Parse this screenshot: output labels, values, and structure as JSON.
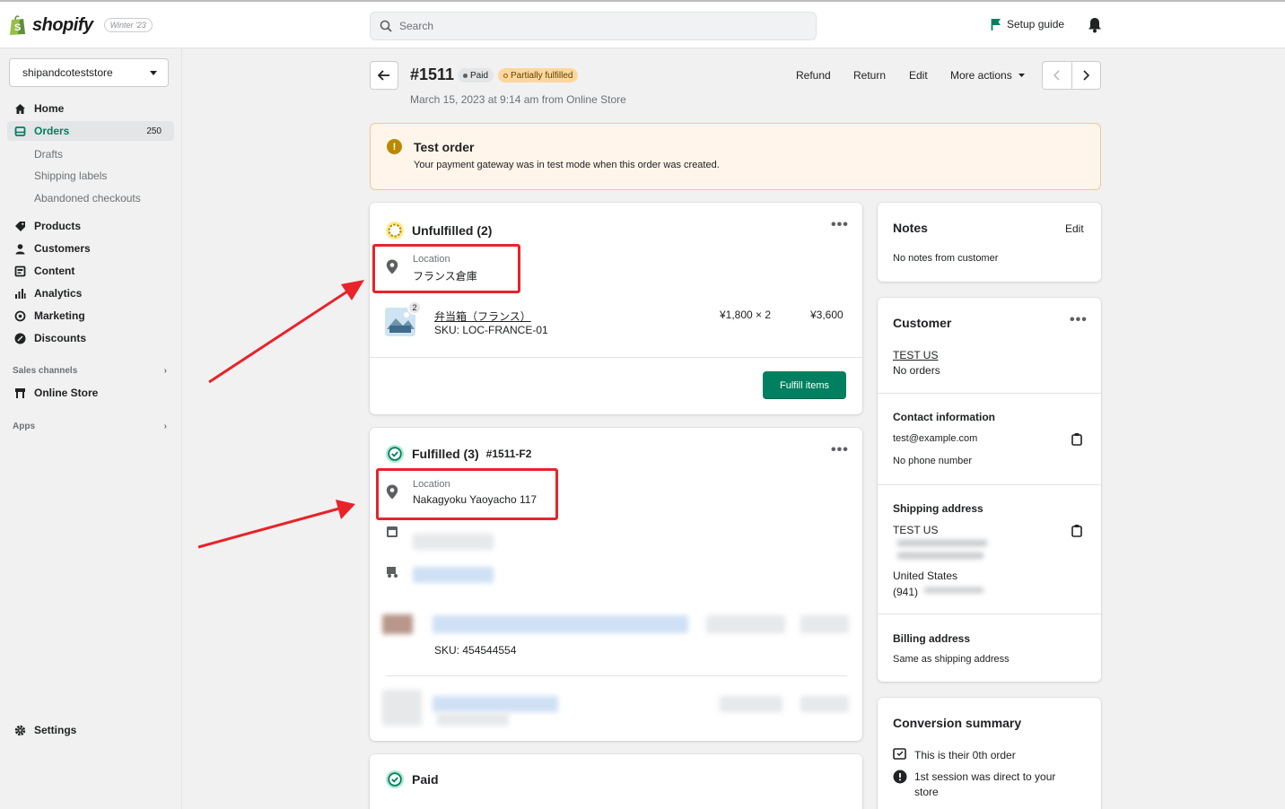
{
  "topbar": {
    "brand": "shopify",
    "edition": "Winter '23",
    "search_placeholder": "Search",
    "setup_guide": "Setup guide"
  },
  "sidebar": {
    "store": "shipandcoteststore",
    "items": [
      {
        "label": "Home",
        "icon": "home-icon"
      },
      {
        "label": "Orders",
        "icon": "orders-icon",
        "count": "250"
      },
      {
        "label": "Products",
        "icon": "tag-icon"
      },
      {
        "label": "Customers",
        "icon": "person-icon"
      },
      {
        "label": "Content",
        "icon": "content-icon"
      },
      {
        "label": "Analytics",
        "icon": "analytics-icon"
      },
      {
        "label": "Marketing",
        "icon": "marketing-icon"
      },
      {
        "label": "Discounts",
        "icon": "discount-icon"
      }
    ],
    "order_subitems": [
      "Drafts",
      "Shipping labels",
      "Abandoned checkouts"
    ],
    "sales_channels_label": "Sales channels",
    "online_store": "Online Store",
    "apps_label": "Apps",
    "settings": "Settings"
  },
  "order": {
    "number": "#1511",
    "badge_paid": "Paid",
    "badge_partial": "Partially fulfilled",
    "subtitle": "March 15, 2023 at 9:14 am from Online Store",
    "actions": [
      "Refund",
      "Return",
      "Edit",
      "More actions"
    ]
  },
  "banner": {
    "title": "Test order",
    "text": "Your payment gateway was in test mode when this order was created."
  },
  "unfulfilled": {
    "title": "Unfulfilled (2)",
    "location_label": "Location",
    "location_value": "フランス倉庫",
    "item_name": "弁当箱（フランス）",
    "item_sku": "SKU: LOC-FRANCE-01",
    "item_qty_badge": "2",
    "item_price": "¥1,800 × 2",
    "item_total": "¥3,600",
    "button": "Fulfill items"
  },
  "fulfilled": {
    "title": "Fulfilled (3)",
    "fulfillment_id": "#1511-F2",
    "location_label": "Location",
    "location_value": "Nakagyoku Yaoyacho 117",
    "sku": "SKU: 454544554"
  },
  "paid": {
    "title": "Paid"
  },
  "notes": {
    "title": "Notes",
    "edit": "Edit",
    "text": "No notes from customer"
  },
  "customer": {
    "title": "Customer",
    "name": "TEST US",
    "orders": "No orders",
    "contact_title": "Contact information",
    "email": "test@example.com",
    "phone": "No phone number",
    "shipping_title": "Shipping address",
    "shipping_name": "TEST US",
    "shipping_country": "United States",
    "shipping_phone_prefix": "(941)",
    "billing_title": "Billing address",
    "billing_text": "Same as shipping address"
  },
  "conversion": {
    "title": "Conversion summary",
    "line1": "This is their 0th order",
    "line2a": "1st session was direct to your",
    "line2b": "store"
  },
  "colors": {
    "accent_green": "#008060",
    "annotation_red": "#e8232a",
    "link_blue": "#2c6ecb",
    "banner_bg": "#fff5ea"
  }
}
